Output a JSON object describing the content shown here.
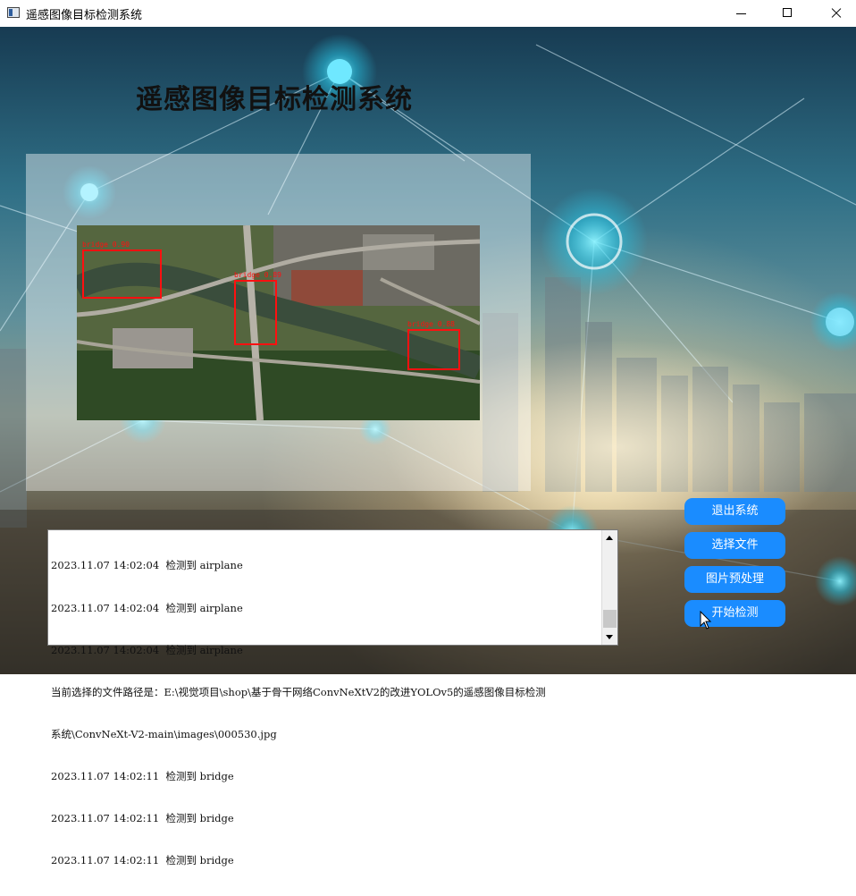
{
  "window": {
    "title": "遥感图像目标检测系统",
    "controls": {
      "minimize": "minimize-icon",
      "maximize": "maximize-icon",
      "close": "close-icon"
    }
  },
  "header": {
    "title": "遥感图像目标检测系统"
  },
  "detections": [
    {
      "label": "bridge 0.90"
    },
    {
      "label": "bridge 0.89"
    },
    {
      "label": "bridge 0.88"
    }
  ],
  "log": {
    "lines": [
      "2023.11.07 14:02:04  检测到 airplane",
      "2023.11.07 14:02:04  检测到 airplane",
      "2023.11.07 14:02:04  检测到 airplane",
      "当前选择的文件路径是：E:\\视觉项目\\shop\\基于骨干网络ConvNeXtV2的改进YOLOv5的遥感图像目标检测",
      "系统\\ConvNeXt-V2-main\\images\\000530.jpg",
      "2023.11.07 14:02:11  检测到 bridge",
      "2023.11.07 14:02:11  检测到 bridge",
      "2023.11.07 14:02:11  检测到 bridge"
    ]
  },
  "buttons": {
    "exit": "退出系统",
    "select_file": "选择文件",
    "preprocess": "图片预处理",
    "start_detect": "开始检测"
  },
  "colors": {
    "button": "#1a8cff",
    "box": "#ff1010"
  }
}
